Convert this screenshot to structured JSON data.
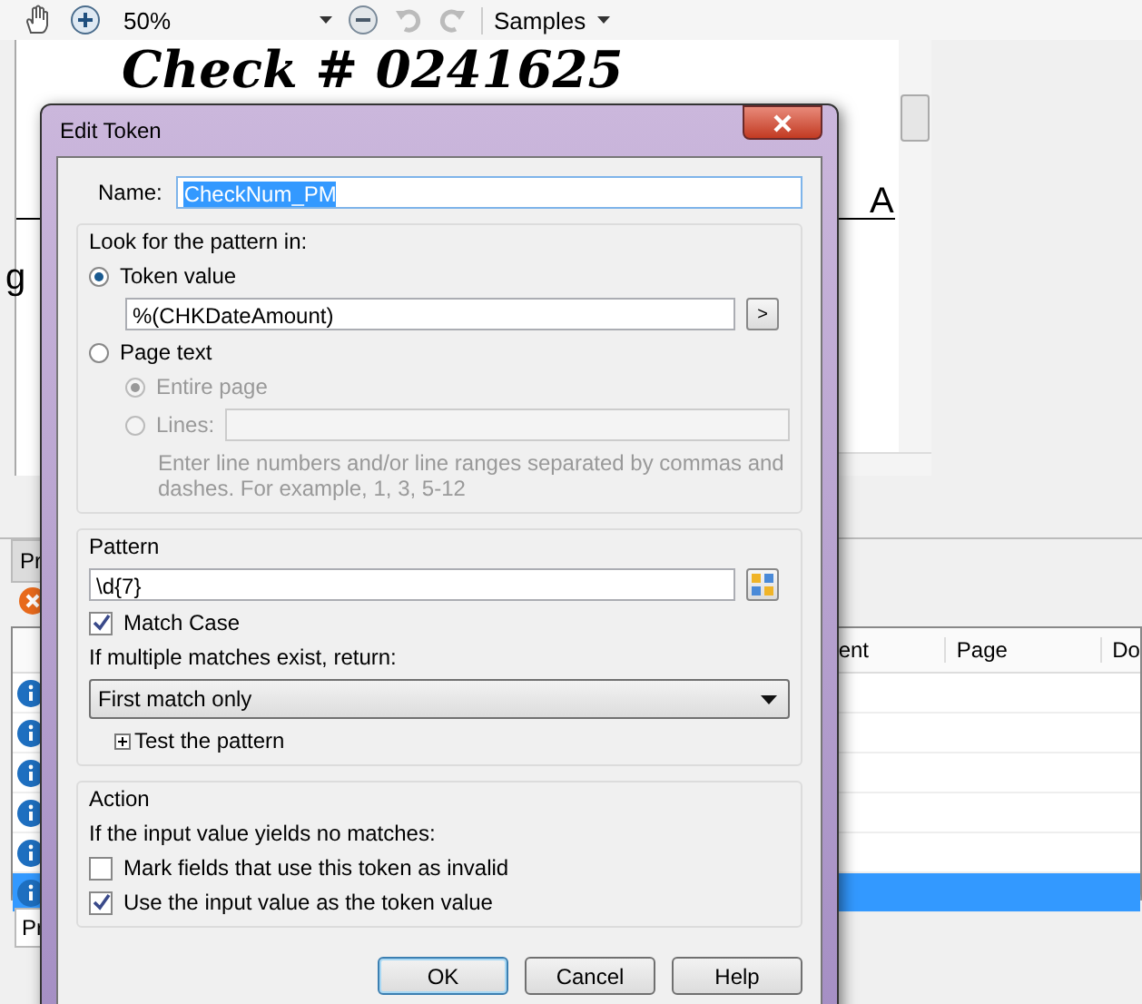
{
  "toolbar": {
    "zoom": "50%",
    "samples": "Samples"
  },
  "document": {
    "heading": "Check # 0241625",
    "fragment_1": "A",
    "fragment_2": "g"
  },
  "panel": {
    "tab": "Pr",
    "columns": [
      "ent",
      "Page",
      "Do"
    ],
    "rows": [
      {
        "selected": false
      },
      {
        "selected": false
      },
      {
        "selected": false
      },
      {
        "selected": false
      },
      {
        "selected": false
      },
      {
        "selected": true
      }
    ],
    "bottom_tab": "Pr"
  },
  "dialog": {
    "title": "Edit Token",
    "name": {
      "label": "Name:",
      "value": "CheckNum_PM",
      "text_selected": true
    },
    "look_for": {
      "legend": "Look for the pattern in:",
      "token_value": {
        "label": "Token value",
        "selected": true,
        "value": "%(CHKDateAmount)",
        "button": ">"
      },
      "page_text": {
        "label": "Page text",
        "selected": false,
        "options": [
          {
            "label": "Entire page",
            "selected": true,
            "disabled": true
          },
          {
            "label": "Lines:",
            "selected": false,
            "disabled": true
          }
        ],
        "hint": "Enter line numbers and/or line ranges separated by commas and dashes.  For example, 1, 3, 5-12"
      }
    },
    "pattern": {
      "legend": "Pattern",
      "value": "\\d{7}",
      "match_case": {
        "label": "Match Case",
        "checked": true
      },
      "multiple_label": "If multiple matches exist, return:",
      "multiple_value": "First match only",
      "test": {
        "label": "Test the pattern",
        "expanded": false
      }
    },
    "action": {
      "legend": "Action",
      "intro": "If the input value yields no matches:",
      "options": [
        {
          "label": "Mark fields that use this token as invalid",
          "checked": false
        },
        {
          "label": "Use the input value as the token value",
          "checked": true
        }
      ]
    },
    "buttons": [
      {
        "label": "OK",
        "default": true
      },
      {
        "label": "Cancel",
        "default": false
      },
      {
        "label": "Help",
        "default": false
      }
    ]
  }
}
